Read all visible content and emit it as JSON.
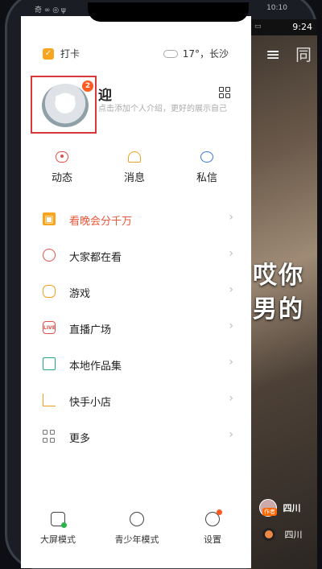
{
  "os_status": {
    "left": "奇  ∞ ◎ ψ",
    "right": "10:10"
  },
  "video": {
    "status_time": "9:24",
    "caption": "哎你\n男的",
    "author_tag": "作者",
    "author_name": "四川",
    "music_name": "四川"
  },
  "drawer": {
    "checkin_label": "打卡",
    "weather": "17°，长沙",
    "badge_count": "2",
    "username": "迎",
    "intro_placeholder": "点击添加个人介绍，更好的展示自己",
    "tabs": [
      {
        "label": "动态",
        "icon": "eye-icon"
      },
      {
        "label": "消息",
        "icon": "bell-icon"
      },
      {
        "label": "私信",
        "icon": "chat-icon"
      }
    ],
    "menu": [
      {
        "label": "看晚会分千万",
        "icon": "gift-icon"
      },
      {
        "label": "大家都在看",
        "icon": "planet-icon"
      },
      {
        "label": "游戏",
        "icon": "gamepad-icon"
      },
      {
        "label": "直播广场",
        "icon": "live-icon",
        "icon_text": "LIVE"
      },
      {
        "label": "本地作品集",
        "icon": "folder-icon"
      },
      {
        "label": "快手小店",
        "icon": "cart-icon"
      },
      {
        "label": "更多",
        "icon": "grid-icon"
      }
    ],
    "bottom": [
      {
        "label": "大屏模式",
        "icon": "tv-icon"
      },
      {
        "label": "青少年模式",
        "icon": "kid-face-icon"
      },
      {
        "label": "设置",
        "icon": "settings-icon"
      }
    ]
  },
  "colors": {
    "accent_orange": "#f7a51e",
    "hot_red": "#e8573a",
    "highlight_box": "#d9383a",
    "badge": "#ff5a1f"
  }
}
